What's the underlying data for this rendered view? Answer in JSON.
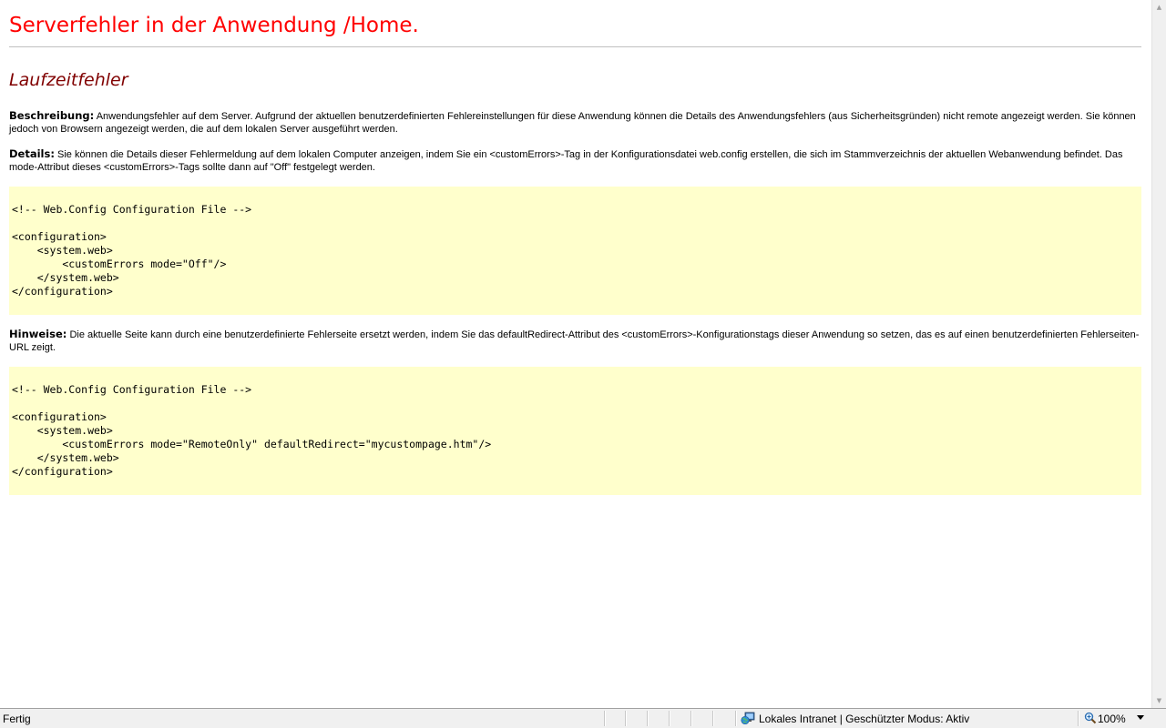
{
  "page": {
    "title": "Serverfehler in der Anwendung /Home.",
    "subtitle": "Laufzeitfehler",
    "description": {
      "label": "Beschreibung:",
      "text": "Anwendungsfehler auf dem Server. Aufgrund der aktuellen benutzerdefinierten Fehlereinstellungen für diese Anwendung können die Details des Anwendungsfehlers (aus Sicherheitsgründen) nicht remote angezeigt werden. Sie können jedoch von Browsern angezeigt werden, die auf dem lokalen Server ausgeführt werden."
    },
    "details": {
      "label": "Details:",
      "text": "Sie können die Details dieser Fehlermeldung auf dem lokalen Computer anzeigen, indem Sie ein <customErrors>-Tag in der Konfigurationsdatei web.config erstellen, die sich im Stammverzeichnis der aktuellen Webanwendung befindet. Das mode-Attribut dieses <customErrors>-Tags sollte dann auf \"Off\" festgelegt werden."
    },
    "code1": "<!-- Web.Config Configuration File -->\n\n<configuration>\n    <system.web>\n        <customErrors mode=\"Off\"/>\n    </system.web>\n</configuration>",
    "hints": {
      "label": "Hinweise:",
      "text": "Die aktuelle Seite kann durch eine benutzerdefinierte Fehlerseite ersetzt werden, indem Sie das defaultRedirect-Attribut des <customErrors>-Konfigurationstags dieser Anwendung so setzen, das es auf einen benutzerdefinierten Fehlerseiten-URL zeigt."
    },
    "code2": "<!-- Web.Config Configuration File -->\n\n<configuration>\n    <system.web>\n        <customErrors mode=\"RemoteOnly\" defaultRedirect=\"mycustompage.htm\"/>\n    </system.web>\n</configuration>"
  },
  "statusbar": {
    "status": "Fertig",
    "zone": "Lokales Intranet | Geschützter Modus: Aktiv",
    "zoom": "100%",
    "icons": [
      "intranet-zone-icon",
      "zoom-magnifier-icon",
      "chevron-down-icon"
    ]
  }
}
